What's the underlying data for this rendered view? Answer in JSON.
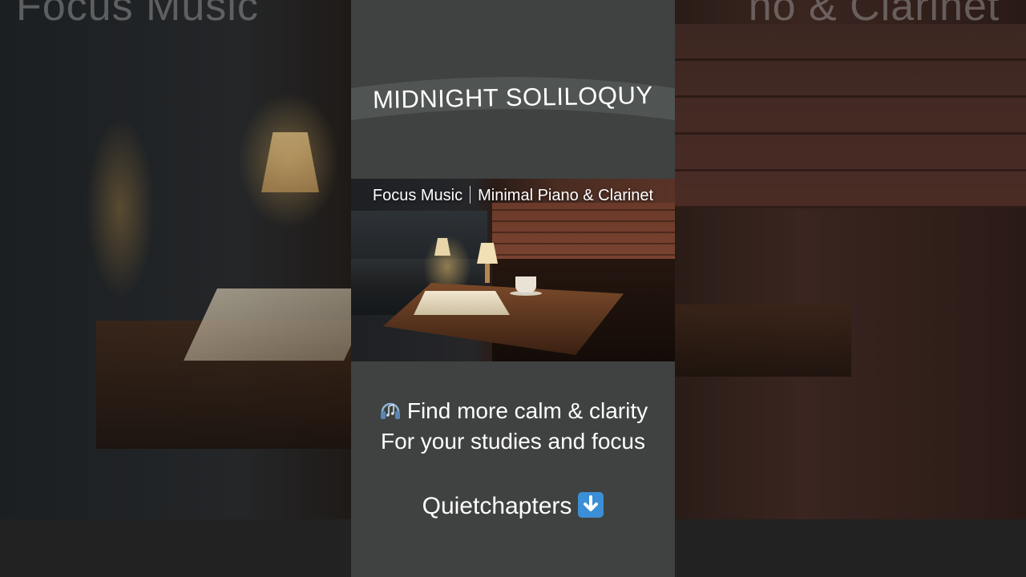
{
  "background": {
    "blurred_title_left": "Focus Music",
    "blurred_title_right": "no &  Clarinet"
  },
  "panel": {
    "title": "MIDNIGHT SOLILOQUY",
    "thumbnail": {
      "subtitle_left": "Focus Music",
      "subtitle_right": "Minimal Piano &  Clarinet"
    },
    "cta_line_1": "Find more calm & clarity",
    "cta_line_2": "For your studies and focus",
    "channel_name": "Quietchapters",
    "icons": {
      "cta_icon": "headphones-music-icon",
      "channel_icon": "down-arrow-icon"
    }
  },
  "colors": {
    "panel_bg": "#3f4240",
    "title_band": "#505452",
    "down_arrow_bg": "#3a8fd6",
    "text": "#ffffff"
  }
}
